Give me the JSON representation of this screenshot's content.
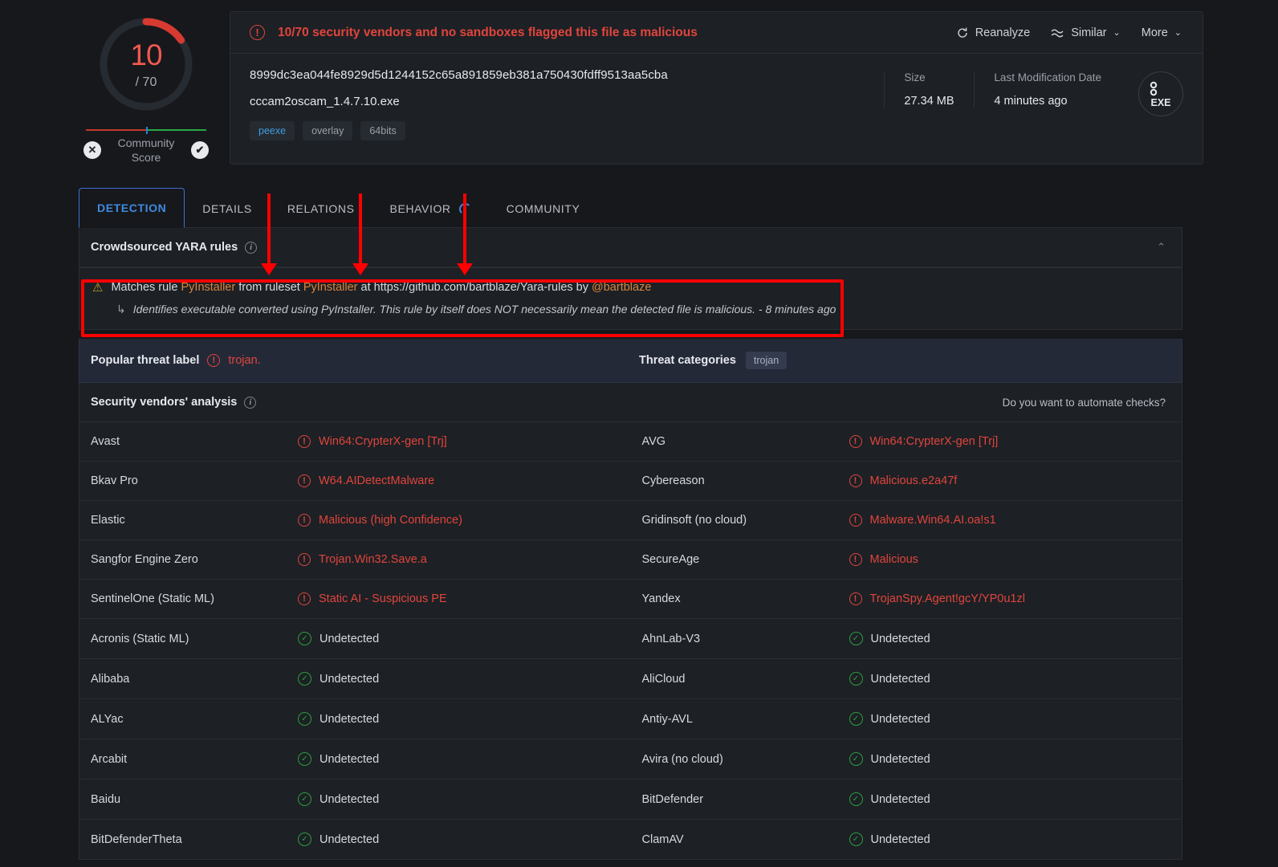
{
  "score": {
    "detections": "10",
    "total": "/ 70",
    "community_label_line1": "Community",
    "community_label_line2": "Score",
    "negative_icon": "✕",
    "positive_icon": "✔"
  },
  "banner": {
    "icon": "!",
    "text": "10/70 security vendors and no sandboxes flagged this file as malicious",
    "actions": [
      {
        "label": "Reanalyze",
        "icon": "reanalyze-icon",
        "chevron": ""
      },
      {
        "label": "Similar",
        "icon": "similar-icon",
        "chevron": "⌄"
      },
      {
        "label": "More",
        "icon": "",
        "chevron": "⌄"
      }
    ]
  },
  "file": {
    "hash": "8999dc3ea044fe8929d5d1244152c65a891859eb381a750430fdff9513aa5cba",
    "name": "cccam2oscam_1.4.7.10.exe",
    "tags": [
      "peexe",
      "overlay",
      "64bits"
    ],
    "size_label": "Size",
    "size_value": "27.34 MB",
    "modified_label": "Last Modification Date",
    "modified_value": "4 minutes ago",
    "filetype_icon_label": "EXE"
  },
  "tabs": [
    {
      "label": "DETECTION",
      "active": true,
      "spinner": false
    },
    {
      "label": "DETAILS",
      "active": false,
      "spinner": false
    },
    {
      "label": "RELATIONS",
      "active": false,
      "spinner": false
    },
    {
      "label": "BEHAVIOR",
      "active": false,
      "spinner": true
    },
    {
      "label": "COMMUNITY",
      "active": false,
      "spinner": false
    }
  ],
  "yara": {
    "title": "Crowdsourced YARA rules",
    "info_icon": "i",
    "collapse_icon": "⌃",
    "warning_icon": "⚠",
    "line1_prefix": "Matches rule ",
    "rule_name": "PyInstaller",
    "line1_mid": " from ruleset ",
    "ruleset_name": "PyInstaller",
    "line1_at": " at https://github.com/bartblaze/Yara-rules by ",
    "author": "@bartblaze",
    "sub_arrow": "↳",
    "description": "Identifies executable converted using PyInstaller. This rule by itself does NOT necessarily mean the detected file is malicious. - 8 minutes ago"
  },
  "threat": {
    "label": "Popular threat label",
    "icon": "!",
    "value": "trojan.",
    "categories_label": "Threat categories",
    "categories": [
      "trojan"
    ]
  },
  "vendors_section": {
    "title": "Security vendors' analysis",
    "info_icon": "i",
    "automate_link": "Do you want to automate checks?"
  },
  "vendor_rows": [
    {
      "left": {
        "name": "Avast",
        "result": "Win64:CrypterX-gen [Trj]",
        "detected": true
      },
      "right": {
        "name": "AVG",
        "result": "Win64:CrypterX-gen [Trj]",
        "detected": true
      }
    },
    {
      "left": {
        "name": "Bkav Pro",
        "result": "W64.AIDetectMalware",
        "detected": true
      },
      "right": {
        "name": "Cybereason",
        "result": "Malicious.e2a47f",
        "detected": true
      }
    },
    {
      "left": {
        "name": "Elastic",
        "result": "Malicious (high Confidence)",
        "detected": true
      },
      "right": {
        "name": "Gridinsoft (no cloud)",
        "result": "Malware.Win64.AI.oa!s1",
        "detected": true
      }
    },
    {
      "left": {
        "name": "Sangfor Engine Zero",
        "result": "Trojan.Win32.Save.a",
        "detected": true
      },
      "right": {
        "name": "SecureAge",
        "result": "Malicious",
        "detected": true
      }
    },
    {
      "left": {
        "name": "SentinelOne (Static ML)",
        "result": "Static AI - Suspicious PE",
        "detected": true
      },
      "right": {
        "name": "Yandex",
        "result": "TrojanSpy.Agent!gcY/YP0u1zl",
        "detected": true
      }
    },
    {
      "left": {
        "name": "Acronis (Static ML)",
        "result": "Undetected",
        "detected": false
      },
      "right": {
        "name": "AhnLab-V3",
        "result": "Undetected",
        "detected": false
      }
    },
    {
      "left": {
        "name": "Alibaba",
        "result": "Undetected",
        "detected": false
      },
      "right": {
        "name": "AliCloud",
        "result": "Undetected",
        "detected": false
      }
    },
    {
      "left": {
        "name": "ALYac",
        "result": "Undetected",
        "detected": false
      },
      "right": {
        "name": "Antiy-AVL",
        "result": "Undetected",
        "detected": false
      }
    },
    {
      "left": {
        "name": "Arcabit",
        "result": "Undetected",
        "detected": false
      },
      "right": {
        "name": "Avira (no cloud)",
        "result": "Undetected",
        "detected": false
      }
    },
    {
      "left": {
        "name": "Baidu",
        "result": "Undetected",
        "detected": false
      },
      "right": {
        "name": "BitDefender",
        "result": "Undetected",
        "detected": false
      }
    },
    {
      "left": {
        "name": "BitDefenderTheta",
        "result": "Undetected",
        "detected": false
      },
      "right": {
        "name": "ClamAV",
        "result": "Undetected",
        "detected": false
      }
    }
  ],
  "colors": {
    "malicious": "#e0453c",
    "clean": "#2b9e3f",
    "accent": "#3f8ae0",
    "annotation": "#ff0000",
    "rule_highlight": "#d9843b"
  }
}
